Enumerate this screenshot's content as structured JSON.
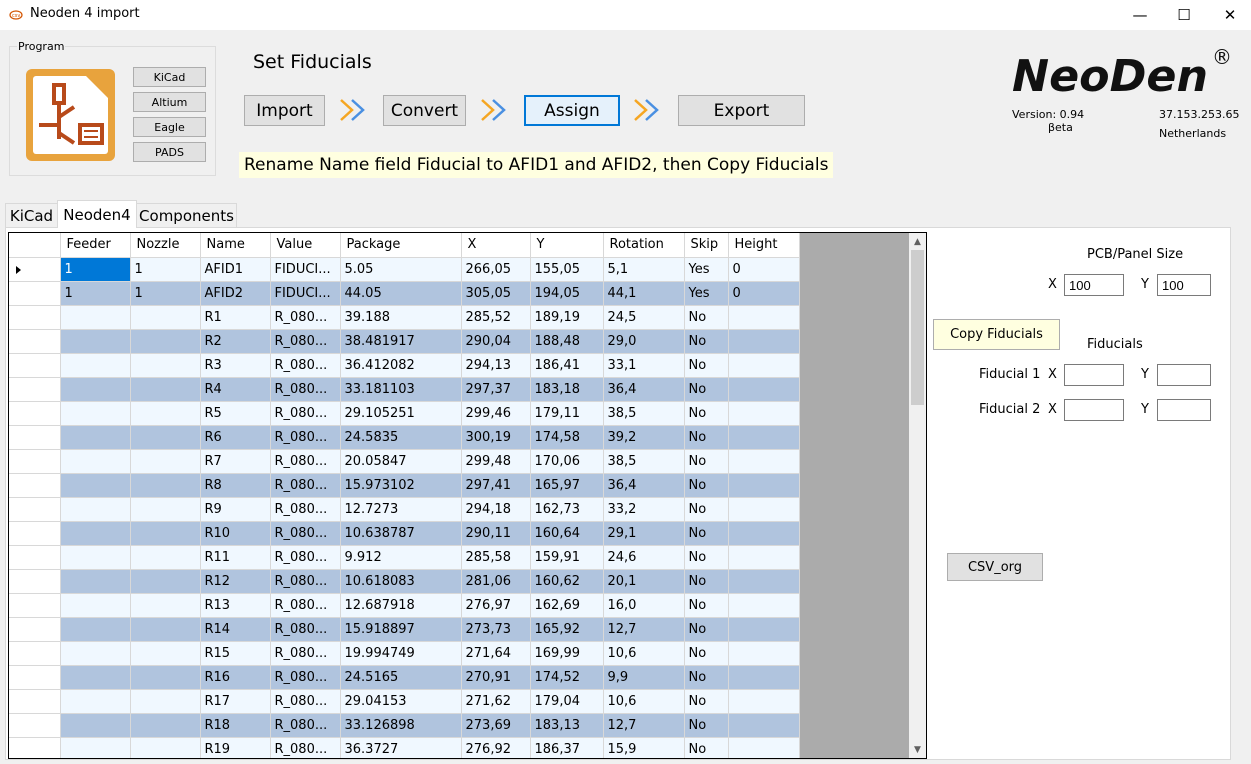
{
  "window": {
    "title": "Neoden 4 import",
    "minimize_glyph": "—",
    "maximize_glyph": "☐",
    "close_glyph": "✕"
  },
  "program": {
    "group_label": "Program",
    "buttons": [
      "KiCad",
      "Altium",
      "Eagle",
      "PADS"
    ]
  },
  "header": {
    "heading": "Set Fiducials",
    "steps": [
      "Import",
      "Convert",
      "Assign",
      "Export"
    ],
    "active_step": "Assign",
    "instruction": "Rename Name field  Fiducial to AFID1 and AFID2, then Copy Fiducials"
  },
  "brand": {
    "logo_text": "NeoDen",
    "registered": "®",
    "version": "Version: 0.94",
    "beta": "βeta",
    "ip": "37.153.253.65",
    "country": "Netherlands"
  },
  "tabs": [
    "KiCad",
    "Neoden4",
    "Components"
  ],
  "selected_tab": "Neoden4",
  "grid": {
    "columns": [
      "Feeder",
      "Nozzle",
      "Name",
      "Value",
      "Package",
      "X",
      "Y",
      "Rotation",
      "Skip",
      "Height"
    ],
    "rows": [
      [
        "1",
        "1",
        "AFID1",
        "FIDUCI...",
        "5.05",
        "266,05",
        "155,05",
        "5,1",
        "Yes",
        "0"
      ],
      [
        "1",
        "1",
        "AFID2",
        "FIDUCI...",
        "44.05",
        "305,05",
        "194,05",
        "44,1",
        "Yes",
        "0"
      ],
      [
        "",
        "",
        "R1",
        "R_080...",
        "39.188",
        "285,52",
        "189,19",
        "24,5",
        "No",
        ""
      ],
      [
        "",
        "",
        "R2",
        "R_080...",
        "38.481917",
        "290,04",
        "188,48",
        "29,0",
        "No",
        ""
      ],
      [
        "",
        "",
        "R3",
        "R_080...",
        "36.412082",
        "294,13",
        "186,41",
        "33,1",
        "No",
        ""
      ],
      [
        "",
        "",
        "R4",
        "R_080...",
        "33.181103",
        "297,37",
        "183,18",
        "36,4",
        "No",
        ""
      ],
      [
        "",
        "",
        "R5",
        "R_080...",
        "29.105251",
        "299,46",
        "179,11",
        "38,5",
        "No",
        ""
      ],
      [
        "",
        "",
        "R6",
        "R_080...",
        "24.5835",
        "300,19",
        "174,58",
        "39,2",
        "No",
        ""
      ],
      [
        "",
        "",
        "R7",
        "R_080...",
        "20.05847",
        "299,48",
        "170,06",
        "38,5",
        "No",
        ""
      ],
      [
        "",
        "",
        "R8",
        "R_080...",
        "15.973102",
        "297,41",
        "165,97",
        "36,4",
        "No",
        ""
      ],
      [
        "",
        "",
        "R9",
        "R_080...",
        "12.7273",
        "294,18",
        "162,73",
        "33,2",
        "No",
        ""
      ],
      [
        "",
        "",
        "R10",
        "R_080...",
        "10.638787",
        "290,11",
        "160,64",
        "29,1",
        "No",
        ""
      ],
      [
        "",
        "",
        "R11",
        "R_080...",
        "9.912",
        "285,58",
        "159,91",
        "24,6",
        "No",
        ""
      ],
      [
        "",
        "",
        "R12",
        "R_080...",
        "10.618083",
        "281,06",
        "160,62",
        "20,1",
        "No",
        ""
      ],
      [
        "",
        "",
        "R13",
        "R_080...",
        "12.687918",
        "276,97",
        "162,69",
        "16,0",
        "No",
        ""
      ],
      [
        "",
        "",
        "R14",
        "R_080...",
        "15.918897",
        "273,73",
        "165,92",
        "12,7",
        "No",
        ""
      ],
      [
        "",
        "",
        "R15",
        "R_080...",
        "19.994749",
        "271,64",
        "169,99",
        "10,6",
        "No",
        ""
      ],
      [
        "",
        "",
        "R16",
        "R_080...",
        "24.5165",
        "270,91",
        "174,52",
        "9,9",
        "No",
        ""
      ],
      [
        "",
        "",
        "R17",
        "R_080...",
        "29.04153",
        "271,62",
        "179,04",
        "10,6",
        "No",
        ""
      ],
      [
        "",
        "",
        "R18",
        "R_080...",
        "33.126898",
        "273,69",
        "183,13",
        "12,7",
        "No",
        ""
      ],
      [
        "",
        "",
        "R19",
        "R_080...",
        "36.3727",
        "276,92",
        "186,37",
        "15,9",
        "No",
        ""
      ]
    ]
  },
  "side": {
    "pcb_size_label": "PCB/Panel Size",
    "x_label": "X",
    "y_label": "Y",
    "pcb_x": "100",
    "pcb_y": "100",
    "copy_button": "Copy Fiducials",
    "fiducials_label": "Fiducials",
    "fiducial1_label": "Fiducial 1",
    "fiducial2_label": "Fiducial 2",
    "f1x": "",
    "f1y": "",
    "f2x": "",
    "f2y": "",
    "csv_button": "CSV_org"
  },
  "colors": {
    "row_odd": "#f0f8ff",
    "row_even": "#b0c4de",
    "selection": "#0078d7",
    "instruction_bg": "#ffffe0",
    "arrow_orange": "#f5a623",
    "arrow_blue": "#4a90e2"
  }
}
